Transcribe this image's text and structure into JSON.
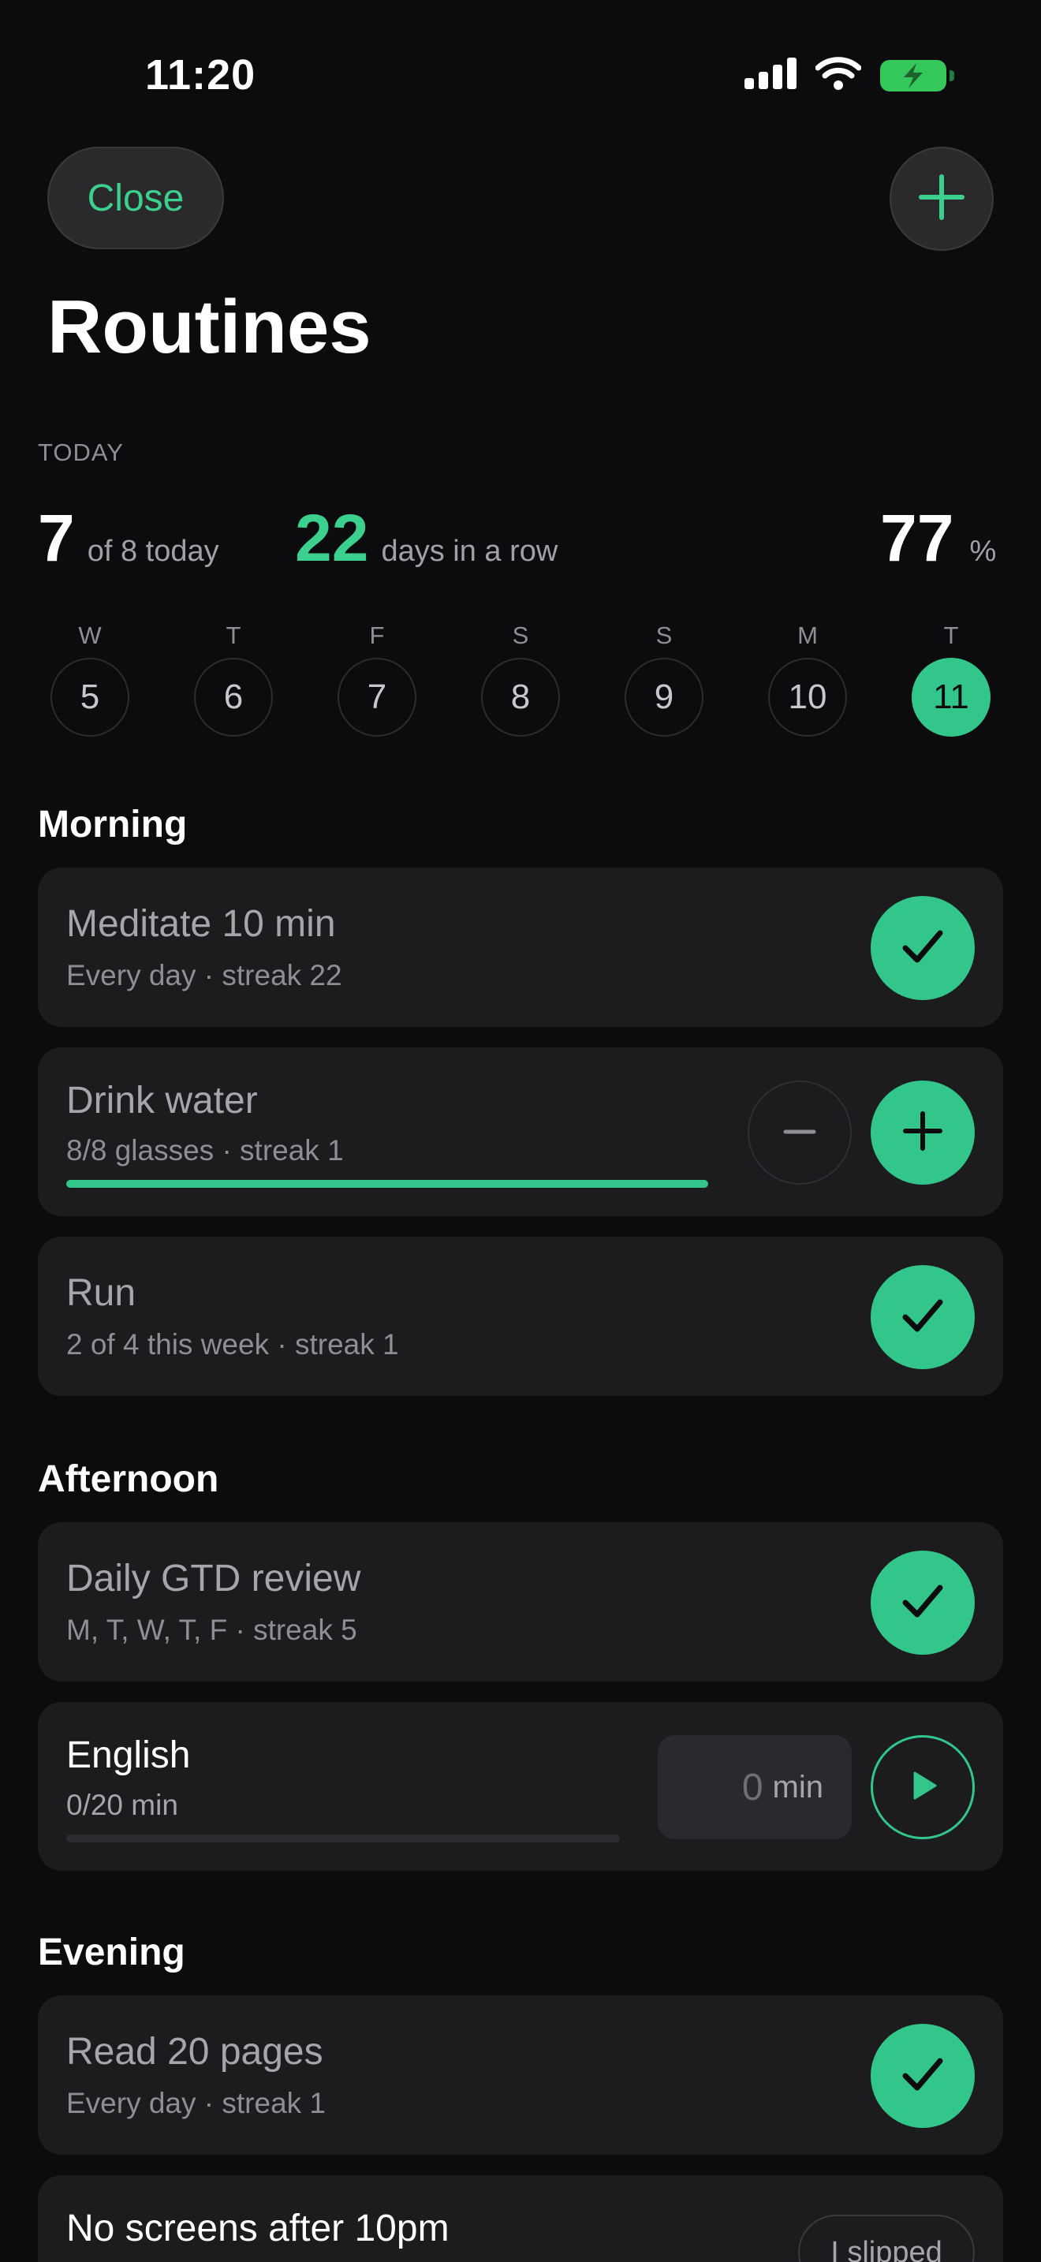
{
  "status_bar": {
    "time": "11:20"
  },
  "header": {
    "close_label": "Close",
    "title": "Routines"
  },
  "stats": {
    "section_label": "TODAY",
    "done_count": "7",
    "done_label": "of 8 today",
    "streak_count": "22",
    "streak_label": "days in a row",
    "percent": "77",
    "percent_unit": "%"
  },
  "week": [
    {
      "letter": "W",
      "date": "5"
    },
    {
      "letter": "T",
      "date": "6"
    },
    {
      "letter": "F",
      "date": "7"
    },
    {
      "letter": "S",
      "date": "8"
    },
    {
      "letter": "S",
      "date": "9"
    },
    {
      "letter": "M",
      "date": "10"
    },
    {
      "letter": "T",
      "date": "11"
    }
  ],
  "sections": {
    "morning": "Morning",
    "afternoon": "Afternoon",
    "evening": "Evening"
  },
  "routines": {
    "meditate": {
      "title": "Meditate 10 min",
      "sub": "Every day · streak 22"
    },
    "water": {
      "title": "Drink water",
      "sub": "8/8 glasses · streak 1",
      "progress": 1.0
    },
    "run": {
      "title": "Run",
      "sub": "2 of 4 this week · streak 1"
    },
    "gtd": {
      "title": "Daily GTD review",
      "sub": "M, T, W, T, F · streak 5"
    },
    "english": {
      "title": "English",
      "sub": "0/20 min",
      "progress": 0.0,
      "minutes_value": "0",
      "minutes_unit": "min"
    },
    "read": {
      "title": "Read 20 pages",
      "sub": "Every day · streak 1"
    },
    "screens": {
      "title": "No screens after 10pm",
      "slip_label": "I slipped"
    }
  },
  "colors": {
    "accent": "#33c68a",
    "background": "#0c0c0e",
    "card": "#1c1c1f"
  }
}
